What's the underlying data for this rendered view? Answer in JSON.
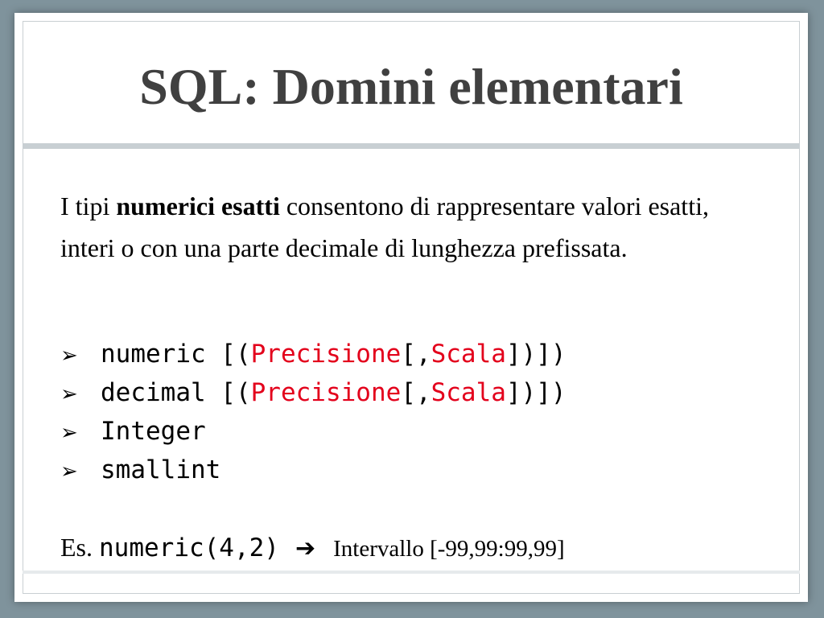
{
  "slide": {
    "title": "SQL: Domini elementari",
    "intro": {
      "prefix": "I tipi ",
      "bold": "numerici esatti",
      "suffix": " consentono di rappresentare valori esatti, interi o con una parte decimale di lunghezza prefissata."
    },
    "bullets": [
      {
        "keyword": "numeric [(",
        "p1": "Precisione",
        "mid": "[,",
        "p2": "Scala",
        "end": "])])"
      },
      {
        "keyword": "decimal [(",
        "p1": "Precisione",
        "mid": "[,",
        "p2": "Scala",
        "end": "])])"
      },
      {
        "keyword": "Integer"
      },
      {
        "keyword": "smallint"
      }
    ],
    "bullet_icon": "arrowhead-bullet-icon",
    "example": {
      "label": "Es. ",
      "code": "numeric(4,2)",
      "arrow_icon": "right-arrow-icon",
      "range": "Intervallo [-99,99:99,99]"
    },
    "colors": {
      "background": "#7f939c",
      "title": "#404040",
      "parameter": "#e3001b",
      "rule": "#c8cfd3"
    }
  }
}
